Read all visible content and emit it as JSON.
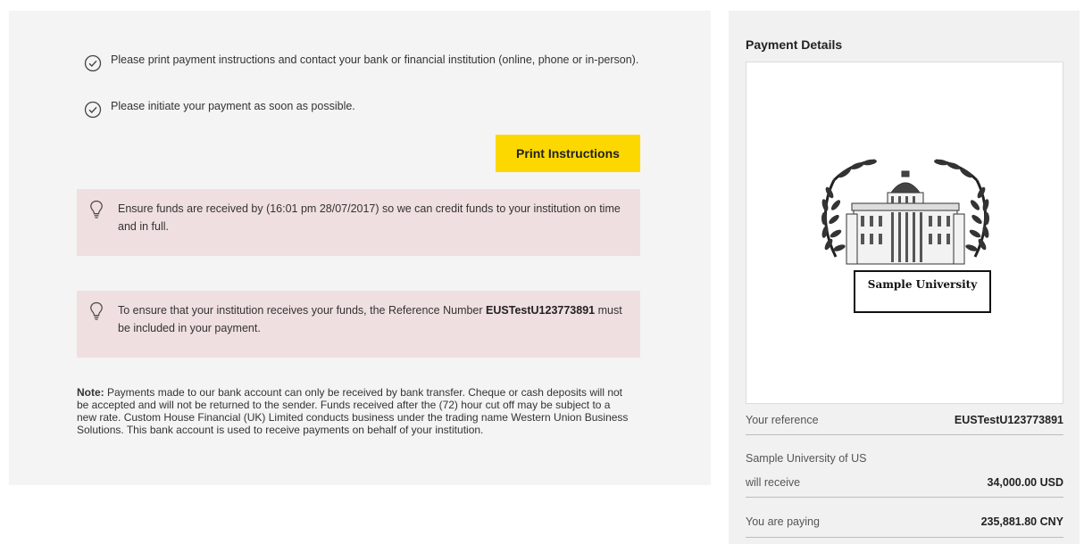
{
  "steps": [
    {
      "text": "Please print payment instructions and contact your bank or financial institution (online, phone or in-person)."
    },
    {
      "text": "Please initiate your payment as soon as possible."
    }
  ],
  "print_button": {
    "label": "Print Instructions"
  },
  "notices": [
    {
      "text": "Ensure funds are received by (16:01 pm 28/07/2017) so we can credit funds to your institution on time and in full."
    },
    {
      "prefix": "To ensure that your institution receives your funds, the Reference Number ",
      "reference": "EUSTestU123773891",
      "suffix": " must be included in your payment."
    }
  ],
  "note": {
    "label": "Note:",
    "text": " Payments made to our bank account can only be received by bank transfer. Cheque or cash deposits will not be accepted and will not be returned to the sender. Funds received after the (72) hour cut off may be subject to a new rate. Custom House Financial (UK) Limited conducts business under the trading name Western Union Business Solutions. This bank account is used to receive payments on behalf of your institution."
  },
  "payment_details": {
    "title": "Payment Details",
    "logo_text": "Sample University",
    "your_reference": {
      "label": "Your reference",
      "value": "EUSTestU123773891"
    },
    "recipient_name": "Sample University of US",
    "will_receive": {
      "label": "will receive",
      "value": "34,000.00 USD"
    },
    "you_are_paying": {
      "label": "You are paying",
      "value": "235,881.80 CNY"
    }
  },
  "colors": {
    "accent_button": "#fcd800",
    "notice_bg": "#f0dfe0",
    "panel_bg": "#f4f4f4"
  },
  "icons": {
    "step": "check-circle-icon",
    "notice": "lightbulb-icon"
  }
}
